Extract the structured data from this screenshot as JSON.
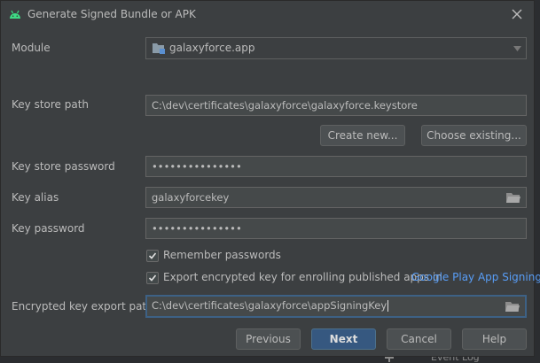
{
  "window": {
    "title": "Generate Signed Bundle or APK"
  },
  "icons": {
    "app": "android-icon",
    "close": "close-icon",
    "module": "module-folder-icon",
    "dropdown": "chevron-down-icon",
    "browse": "folder-icon",
    "check": "checkmark-icon"
  },
  "colors": {
    "dialog_bg": "#3c3f41",
    "field_bg": "#45494a",
    "primary_button": "#365880",
    "link": "#589df6",
    "android_green": "#3ddc84",
    "focus_border": "#3d6185"
  },
  "module": {
    "label": "Module",
    "value": "galaxyforce.app"
  },
  "keystore": {
    "path_label": "Key store path",
    "path_value": "C:\\dev\\certificates\\galaxyforce\\galaxyforce.keystore",
    "create_new": "Create new...",
    "choose_existing": "Choose existing...",
    "password_label": "Key store password",
    "password_value": "•••••••••••••••"
  },
  "key": {
    "alias_label": "Key alias",
    "alias_value": "galaxyforcekey",
    "password_label": "Key password",
    "password_value": "•••••••••••••••"
  },
  "options": {
    "remember_passwords": {
      "label": "Remember passwords",
      "checked": true
    },
    "export_encrypted": {
      "label": "Export encrypted key for enrolling published apps in",
      "link": "Google Play App Signing",
      "checked": true
    }
  },
  "export": {
    "path_label": "Encrypted key export path",
    "path_value": "C:\\dev\\certificates\\galaxyforce\\appSigningKey"
  },
  "buttons": {
    "previous": "Previous",
    "next": "Next",
    "cancel": "Cancel",
    "help": "Help"
  },
  "background": {
    "event_log": "Event Log"
  }
}
